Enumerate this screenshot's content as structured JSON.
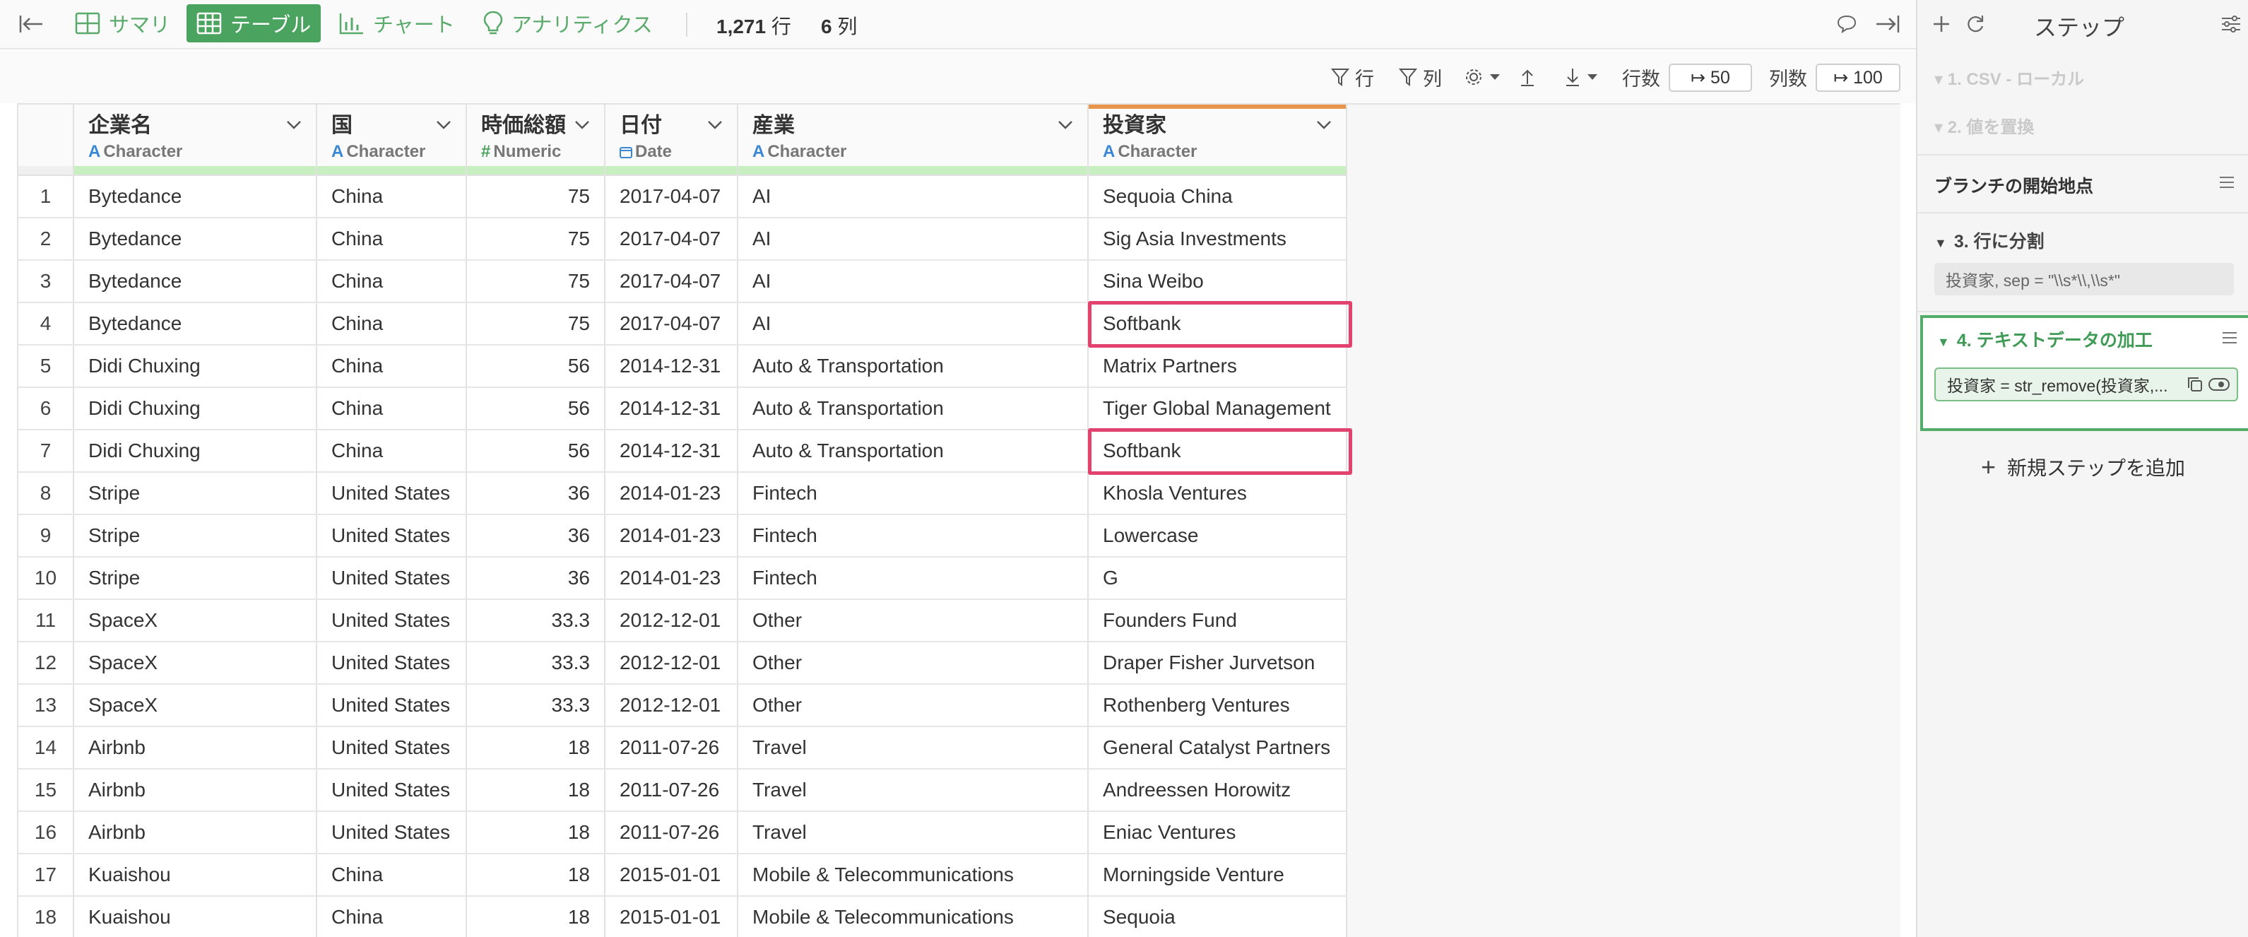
{
  "topbar": {
    "tabs": [
      {
        "label": "サマリ",
        "icon": "summary-icon"
      },
      {
        "label": "テーブル",
        "icon": "table-icon"
      },
      {
        "label": "チャート",
        "icon": "chart-icon"
      },
      {
        "label": "アナリティクス",
        "icon": "bulb-icon"
      }
    ],
    "active_tab": 1,
    "row_count": "1,271",
    "row_unit": "行",
    "col_count": "6",
    "col_unit": "列"
  },
  "toolbar": {
    "filter_rows": "行",
    "filter_cols": "列",
    "rows_label": "行数",
    "rows_value": "↦ 50",
    "cols_label": "列数",
    "cols_value": "↦ 100"
  },
  "table": {
    "columns": [
      {
        "name": "企業名",
        "type": "Character",
        "type_icon": "A"
      },
      {
        "name": "国",
        "type": "Character",
        "type_icon": "A"
      },
      {
        "name": "時価総額",
        "type": "Numeric",
        "type_icon": "#"
      },
      {
        "name": "日付",
        "type": "Date",
        "type_icon": "calendar-icon"
      },
      {
        "name": "産業",
        "type": "Character",
        "type_icon": "A"
      },
      {
        "name": "投資家",
        "type": "Character",
        "type_icon": "A"
      }
    ],
    "rows": [
      [
        "1",
        "Bytedance",
        "China",
        "75",
        "2017-04-07",
        "AI",
        "Sequoia China"
      ],
      [
        "2",
        "Bytedance",
        "China",
        "75",
        "2017-04-07",
        "AI",
        "Sig Asia Investments"
      ],
      [
        "3",
        "Bytedance",
        "China",
        "75",
        "2017-04-07",
        "AI",
        "Sina Weibo"
      ],
      [
        "4",
        "Bytedance",
        "China",
        "75",
        "2017-04-07",
        "AI",
        "Softbank"
      ],
      [
        "5",
        "Didi Chuxing",
        "China",
        "56",
        "2014-12-31",
        "Auto & Transportation",
        "Matrix Partners"
      ],
      [
        "6",
        "Didi Chuxing",
        "China",
        "56",
        "2014-12-31",
        "Auto & Transportation",
        "Tiger Global Management"
      ],
      [
        "7",
        "Didi Chuxing",
        "China",
        "56",
        "2014-12-31",
        "Auto & Transportation",
        "Softbank"
      ],
      [
        "8",
        "Stripe",
        "United States",
        "36",
        "2014-01-23",
        "Fintech",
        "Khosla Ventures"
      ],
      [
        "9",
        "Stripe",
        "United States",
        "36",
        "2014-01-23",
        "Fintech",
        "Lowercase"
      ],
      [
        "10",
        "Stripe",
        "United States",
        "36",
        "2014-01-23",
        "Fintech",
        "G"
      ],
      [
        "11",
        "SpaceX",
        "United States",
        "33.3",
        "2012-12-01",
        "Other",
        "Founders Fund"
      ],
      [
        "12",
        "SpaceX",
        "United States",
        "33.3",
        "2012-12-01",
        "Other",
        "Draper Fisher Jurvetson"
      ],
      [
        "13",
        "SpaceX",
        "United States",
        "33.3",
        "2012-12-01",
        "Other",
        "Rothenberg Ventures"
      ],
      [
        "14",
        "Airbnb",
        "United States",
        "18",
        "2011-07-26",
        "Travel",
        "General Catalyst Partners"
      ],
      [
        "15",
        "Airbnb",
        "United States",
        "18",
        "2011-07-26",
        "Travel",
        "Andreessen Horowitz"
      ],
      [
        "16",
        "Airbnb",
        "United States",
        "18",
        "2011-07-26",
        "Travel",
        "Eniac Ventures"
      ],
      [
        "17",
        "Kuaishou",
        "China",
        "18",
        "2015-01-01",
        "Mobile & Telecommunications",
        "Morningside Venture"
      ],
      [
        "18",
        "Kuaishou",
        "China",
        "18",
        "2015-01-01",
        "Mobile & Telecommunications",
        "Sequoia"
      ]
    ],
    "highlighted_rows": [
      4,
      7
    ]
  },
  "panel": {
    "title": "ステップ",
    "steps_dim": [
      "1. CSV - ローカル",
      "2. 値を置換"
    ],
    "branch_label": "ブランチの開始地点",
    "step3": {
      "label": "3. 行に分割",
      "chip": "投資家, sep = \"\\\\s*\\\\,\\\\s*\""
    },
    "step4": {
      "label": "4. テキストデータの加工",
      "chip": "投資家 = str_remove(投資家,..."
    },
    "add_step": "新規ステップを追加"
  },
  "colors": {
    "accent": "#4aa35e",
    "highlight": "#e2436e",
    "header_underline": "#c8efc0",
    "selected_column_top": "#e8954c"
  }
}
